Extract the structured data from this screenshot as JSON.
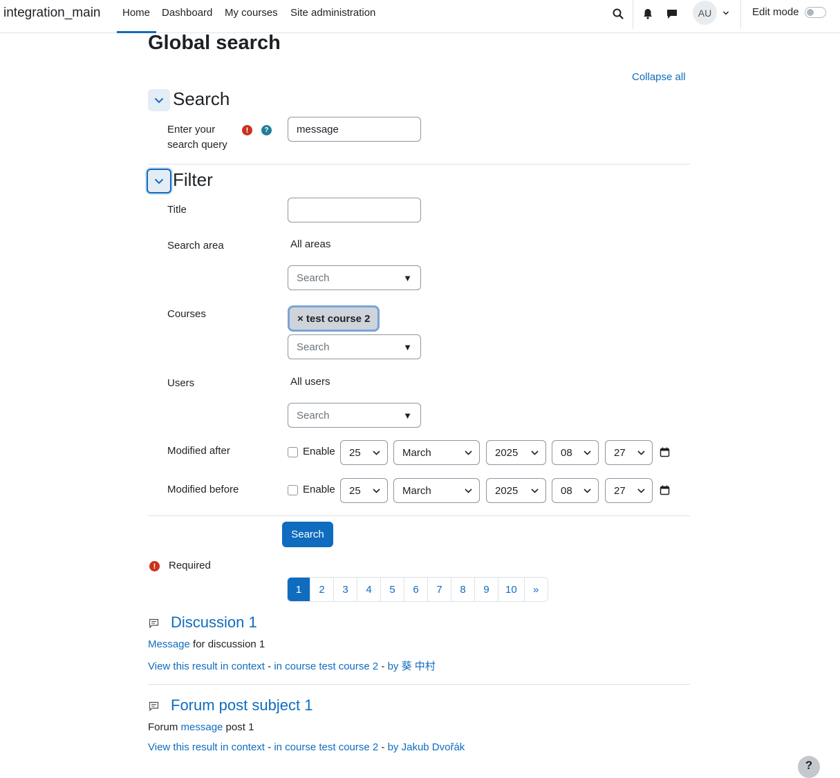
{
  "navbar": {
    "site_name": "integration_main",
    "links": [
      "Home",
      "Dashboard",
      "My courses",
      "Site administration"
    ],
    "avatar_initials": "AU",
    "edit_mode_label": "Edit mode"
  },
  "page": {
    "title": "Global search",
    "collapse_all": "Collapse all"
  },
  "search_section": {
    "heading": "Search",
    "query_label_line1": "Enter your",
    "query_label_line2": "search query",
    "query_value": "message"
  },
  "filter_section": {
    "heading": "Filter",
    "title_label": "Title",
    "title_value": "",
    "search_area_label": "Search area",
    "search_area_value": "All areas",
    "courses_label": "Courses",
    "selected_course_chip": "× test course 2",
    "users_label": "Users",
    "users_value": "All users",
    "search_placeholder": "Search",
    "modified_after_label": "Modified after",
    "modified_before_label": "Modified before",
    "enable_label": "Enable",
    "date": {
      "day": "25",
      "month": "March",
      "year": "2025",
      "hour": "08",
      "minute": "27"
    }
  },
  "submit_label": "Search",
  "required_note": "Required",
  "pagination": {
    "pages": [
      "1",
      "2",
      "3",
      "4",
      "5",
      "6",
      "7",
      "8",
      "9",
      "10"
    ],
    "next": "»",
    "active": "1"
  },
  "results": [
    {
      "title": "Discussion 1",
      "text_link": "Message",
      "text_rest": " for discussion 1",
      "context_link": "View this result in context",
      "sep": " - ",
      "course_link": "in course test course 2",
      "author_link": "by 葵 中村"
    },
    {
      "title": "Forum post subject 1",
      "text_before": "Forum ",
      "text_link": "message",
      "text_rest": " post 1",
      "context_link": "View this result in context",
      "sep": " - ",
      "course_link": "in course test course 2",
      "author_link": "by Jakub Dvořák"
    }
  ],
  "colors": {
    "primary": "#0f6cbf",
    "danger": "#ca3120",
    "info": "#1f7e9a"
  },
  "icons": [
    "search-icon",
    "bell-icon",
    "chat-icon",
    "chevron-down-icon",
    "required-icon",
    "help-icon",
    "calendar-icon",
    "forum-post-icon"
  ]
}
